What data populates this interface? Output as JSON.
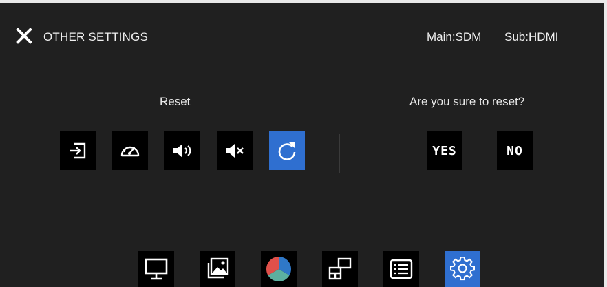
{
  "header": {
    "title": "OTHER SETTINGS",
    "main_source": "Main:SDM",
    "sub_source": "Sub:HDMI"
  },
  "reset": {
    "label": "Reset",
    "icons": [
      "input-source-icon",
      "meter-icon",
      "volume-icon",
      "mute-icon",
      "reset-icon"
    ],
    "active_index": 4
  },
  "confirm": {
    "prompt": "Are you sure to reset?",
    "yes_label": "YES",
    "no_label": "NO"
  },
  "bottom_nav": {
    "items": [
      "monitor-icon",
      "picture-icon",
      "color-icon",
      "layout-icon",
      "list-icon",
      "settings-icon"
    ],
    "active_index": 5
  },
  "colors": {
    "background": "#202020",
    "accent": "#2f6fd0",
    "tile": "#000000",
    "text": "#f0f0f0"
  }
}
